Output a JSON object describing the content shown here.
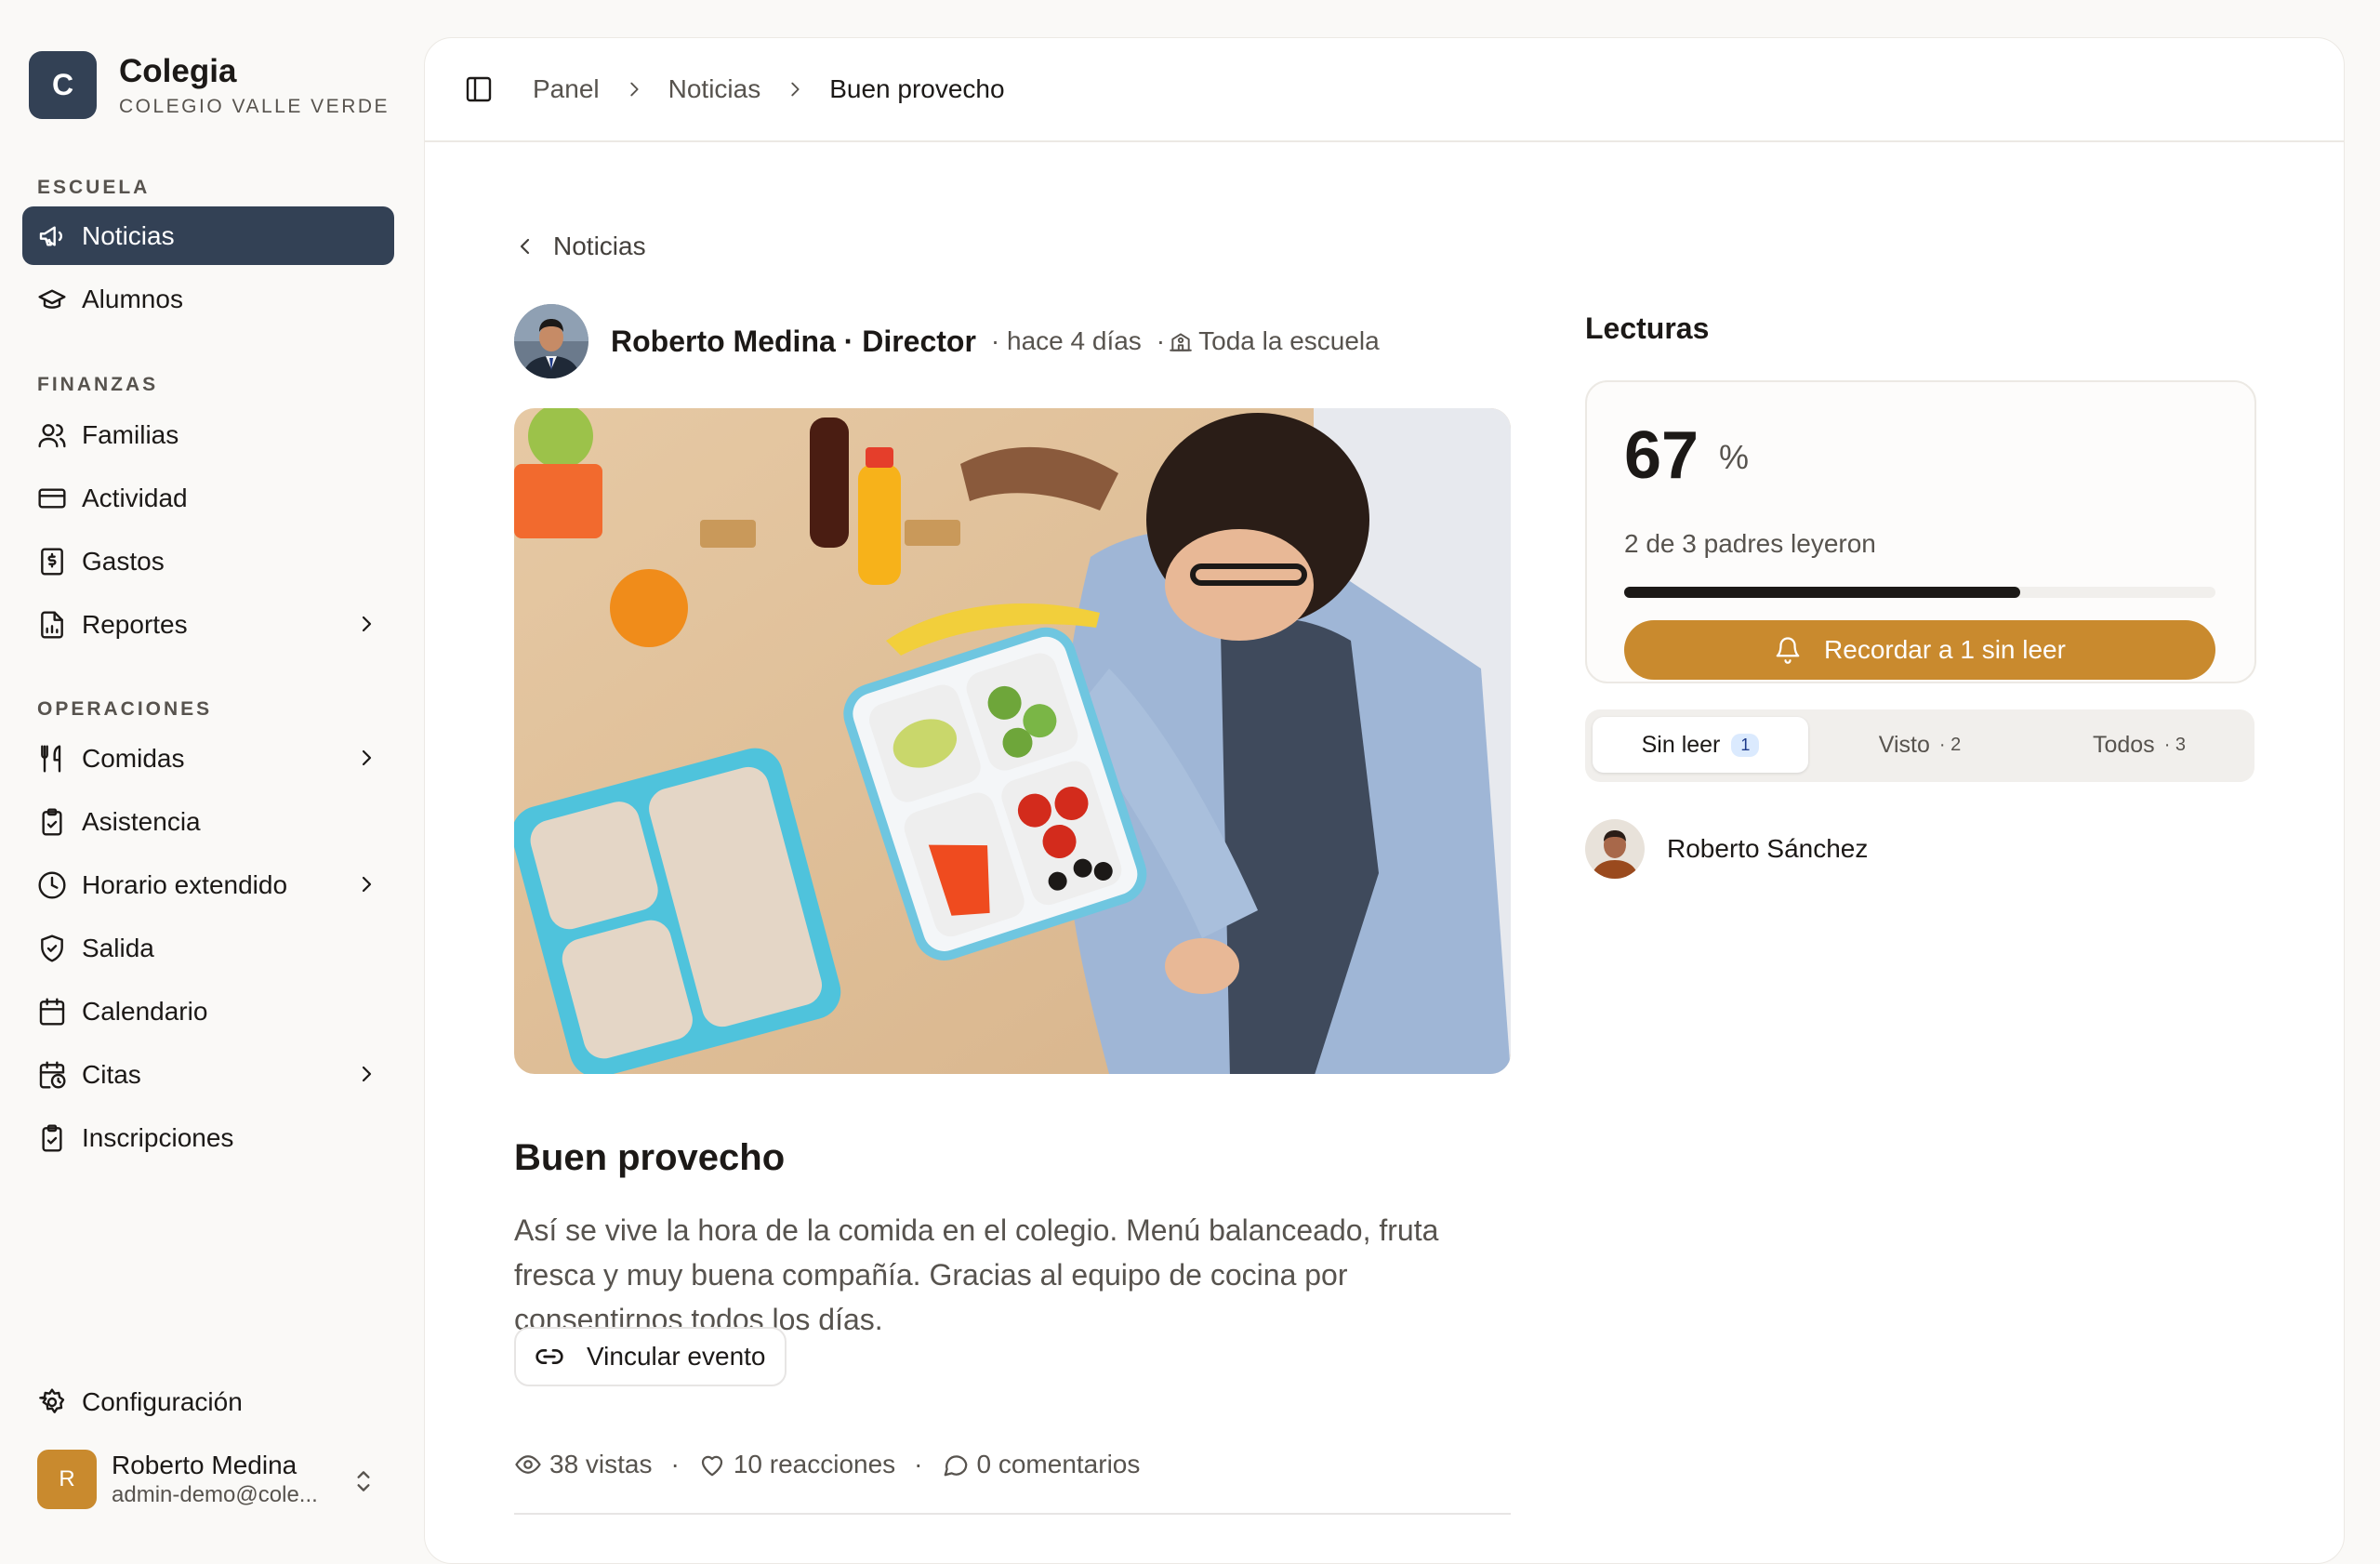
{
  "brand": {
    "initial": "C",
    "name": "Colegia",
    "subtitle": "COLEGIO VALLE VERDE"
  },
  "sidebar": {
    "sections": [
      {
        "label": "ESCUELA",
        "items": [
          {
            "label": "Noticias",
            "icon": "megaphone-icon",
            "active": true
          },
          {
            "label": "Alumnos",
            "icon": "graduation-cap-icon"
          }
        ]
      },
      {
        "label": "FINANZAS",
        "items": [
          {
            "label": "Familias",
            "icon": "users-icon"
          },
          {
            "label": "Actividad",
            "icon": "credit-card-icon"
          },
          {
            "label": "Gastos",
            "icon": "receipt-icon"
          },
          {
            "label": "Reportes",
            "icon": "report-icon",
            "has_children": true
          }
        ]
      },
      {
        "label": "OPERACIONES",
        "items": [
          {
            "label": "Comidas",
            "icon": "utensils-icon",
            "has_children": true
          },
          {
            "label": "Asistencia",
            "icon": "clipboard-check-icon"
          },
          {
            "label": "Horario extendido",
            "icon": "clock-icon",
            "has_children": true
          },
          {
            "label": "Salida",
            "icon": "shield-check-icon"
          },
          {
            "label": "Calendario",
            "icon": "calendar-icon"
          },
          {
            "label": "Citas",
            "icon": "calendar-clock-icon",
            "has_children": true
          },
          {
            "label": "Inscripciones",
            "icon": "clipboard-list-icon"
          }
        ]
      }
    ],
    "settings_label": "Configuración",
    "user": {
      "initial": "R",
      "name": "Roberto Medina",
      "email": "admin-demo@cole..."
    }
  },
  "breadcrumb": [
    "Panel",
    "Noticias",
    "Buen provecho"
  ],
  "post": {
    "back_label": "Noticias",
    "author": "Roberto Medina · Director",
    "time": "· hace 4 días",
    "audience_prefix": "·",
    "audience": "Toda la escuela",
    "title": "Buen provecho",
    "body": "Así se vive la hora de la comida en el colegio. Menú balanceado, fruta fresca y muy buena compañía. Gracias al equipo de cocina por consentirnos todos los días.",
    "link_button": "Vincular evento",
    "views": "38 vistas",
    "reactions": "10 reacciones",
    "comments": "0 comentarios",
    "stat_sep": "·"
  },
  "readings": {
    "title": "Lecturas",
    "percent": "67",
    "percent_sign": "%",
    "summary": "2 de 3 padres leyeron",
    "progress": 0.67,
    "remind_button": "Recordar a 1 sin leer",
    "tabs": [
      {
        "label": "Sin leer",
        "count": "1",
        "active": true
      },
      {
        "label": "Visto",
        "count": "· 2"
      },
      {
        "label": "Todos",
        "count": "· 3"
      }
    ],
    "readers": [
      "Roberto Sánchez"
    ]
  },
  "colors": {
    "accent": "#c98a2e",
    "active_nav": "#334155",
    "badge_bg": "#dbeafe"
  }
}
